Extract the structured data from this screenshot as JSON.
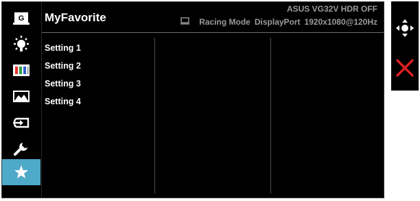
{
  "osd": {
    "title": "MyFavorite",
    "model": "ASUS VG32V HDR OFF",
    "status": {
      "mode": "Racing Mode",
      "input": "DisplayPort",
      "resolution": "1920x1080@120Hz",
      "input_icon": "monitor-icon"
    },
    "sidebar": [
      {
        "icon": "gameplus-icon",
        "label": "G",
        "active": false
      },
      {
        "icon": "brightness-icon",
        "active": false
      },
      {
        "icon": "color-icon",
        "active": false
      },
      {
        "icon": "image-icon",
        "active": false
      },
      {
        "icon": "input-select-icon",
        "active": false
      },
      {
        "icon": "system-setup-icon",
        "active": false
      },
      {
        "icon": "myfavorite-star-icon",
        "active": true
      }
    ],
    "settings": [
      "Setting 1",
      "Setting 2",
      "Setting 3",
      "Setting 4"
    ],
    "colors": {
      "active": "#4fa9c8",
      "background": "#000000",
      "nav_exit": "#e02020"
    }
  },
  "nav": {
    "items": [
      {
        "icon": "five-way-navigation-icon"
      },
      {
        "icon": "exit-close-icon"
      }
    ]
  }
}
